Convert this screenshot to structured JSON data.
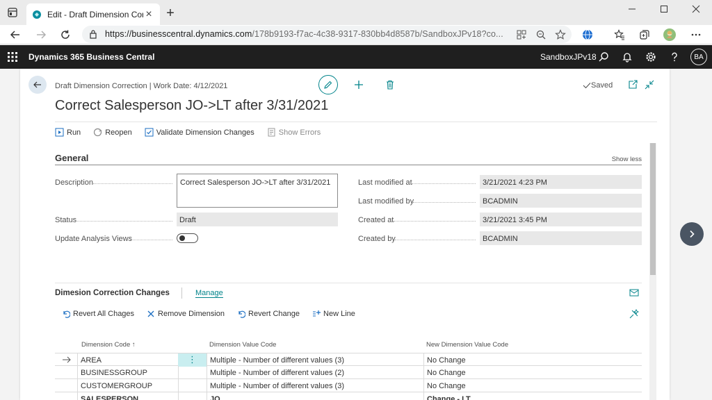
{
  "browser": {
    "tab_title": "Edit - Draft Dimension Correction",
    "url_host": "https://businesscentral.dynamics.com",
    "url_path": "/178b9193-f7ac-4c38-9317-830bb4d8587b/SandboxJPv18?co..."
  },
  "appbar": {
    "product": "Dynamics 365 Business Central",
    "environment": "SandboxJPv18",
    "avatar_initials": "BA"
  },
  "header": {
    "breadcrumb": "Draft Dimension Correction | Work Date: 4/12/2021",
    "saved_label": "Saved",
    "title": "Correct Salesperson JO->LT after 3/31/2021"
  },
  "actions": {
    "run": "Run",
    "reopen": "Reopen",
    "validate": "Validate Dimension Changes",
    "show_errors": "Show Errors"
  },
  "general": {
    "title": "General",
    "show_less": "Show less",
    "description_label": "Description",
    "description_value": "Correct Salesperson JO->LT after 3/31/2021",
    "status_label": "Status",
    "status_value": "Draft",
    "update_label": "Update Analysis Views",
    "update_value": false,
    "last_modified_at_label": "Last modified at",
    "last_modified_at_value": "3/21/2021 4:23 PM",
    "last_modified_by_label": "Last modified by",
    "last_modified_by_value": "BCADMIN",
    "created_at_label": "Created at",
    "created_at_value": "3/21/2021 3:45 PM",
    "created_by_label": "Created by",
    "created_by_value": "BCADMIN"
  },
  "subpage": {
    "title": "Dimesion Correction Changes",
    "manage": "Manage",
    "actions": {
      "revert_all": "Revert All Chages",
      "remove_dimension": "Remove Dimension",
      "revert_change": "Revert Change",
      "new_line": "New Line"
    },
    "columns": {
      "dimension_code": "Dimension Code ↑",
      "dimension_value_code": "Dimension Value Code",
      "new_dimension_value_code": "New Dimension Value Code"
    },
    "rows": [
      {
        "code": "AREA",
        "value": "Multiple - Number of different values (3)",
        "new_value": "No Change"
      },
      {
        "code": "BUSINESSGROUP",
        "value": "Multiple - Number of different values (2)",
        "new_value": "No Change"
      },
      {
        "code": "CUSTOMERGROUP",
        "value": "Multiple - Number of different values (3)",
        "new_value": "No Change"
      },
      {
        "code": "SALESPERSON",
        "value": "JO",
        "new_value": "Change - LT"
      }
    ]
  },
  "colors": {
    "accent": "#00838a",
    "appbar": "#1f1f1f"
  }
}
